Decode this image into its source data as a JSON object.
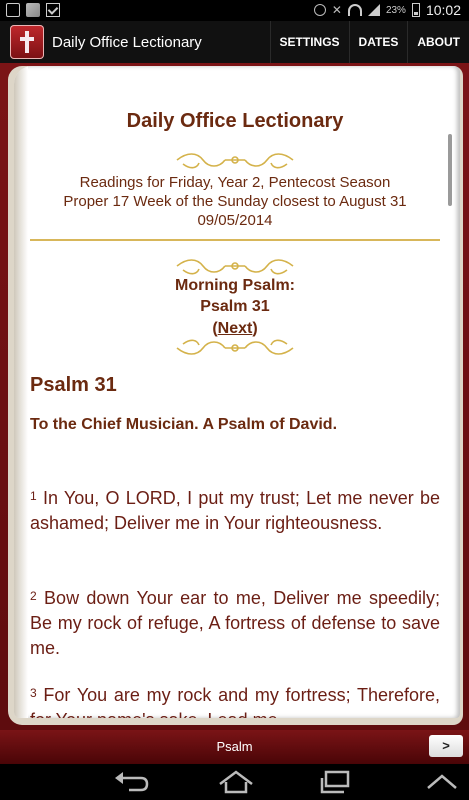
{
  "status_bar": {
    "battery_pct": "23%",
    "time": "10:02"
  },
  "action_bar": {
    "app_title": "Daily Office Lectionary",
    "actions": [
      "SETTINGS",
      "DATES",
      "ABOUT"
    ]
  },
  "page": {
    "title": "Daily Office Lectionary",
    "readings_line1": "Readings for Friday, Year 2, Pentecost Season",
    "readings_line2": "Proper 17 Week of the Sunday closest to August 31",
    "date": "09/05/2014",
    "morning_psalm_label": "Morning Psalm:",
    "psalm_ref": "Psalm 31",
    "next_open": "(",
    "next_link": "Next",
    "next_close": ")",
    "psalm_heading": "Psalm 31",
    "psalm_subtitle": "To the Chief Musician. A Psalm of David.",
    "verses": [
      {
        "num": "1",
        "text": "In You, O LORD, I put my trust; Let me never be ashamed; Deliver me in Your righteousness."
      },
      {
        "num": "2",
        "text": "Bow down Your ear to me, Deliver me speedily; Be my rock of refuge, A fortress of defense to save me."
      },
      {
        "num": "3",
        "text": "For You are my rock and my fortress; Therefore, for Your name's sake, Lead me"
      }
    ]
  },
  "bottom_bar": {
    "label": "Psalm",
    "next_button": ">"
  },
  "nav_icons": [
    "back-icon",
    "home-icon",
    "recent-apps-icon",
    "hide-keyboard-icon"
  ]
}
